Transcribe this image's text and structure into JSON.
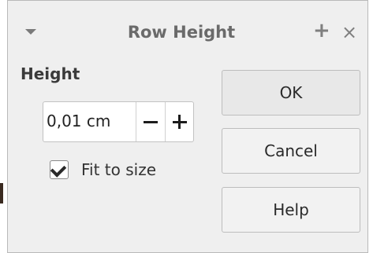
{
  "dialog": {
    "title": "Row Height",
    "menu_icon": "chevron-down-icon",
    "expand_icon": "plus-icon",
    "close_icon": "close-icon",
    "plus_glyph": "+",
    "close_glyph": "×"
  },
  "height_section": {
    "label": "Height",
    "value": "0,01 cm",
    "decrement_icon": "minus-icon",
    "increment_icon": "plus-icon"
  },
  "fit_to_size": {
    "label": "Fit to size",
    "checked": true
  },
  "buttons": {
    "ok": "OK",
    "cancel": "Cancel",
    "help": "Help"
  }
}
